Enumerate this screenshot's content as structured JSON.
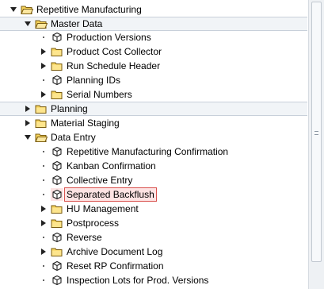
{
  "tree": {
    "root": "Repetitive Manufacturing",
    "master_data": {
      "label": "Master Data",
      "items": [
        "Production Versions",
        "Product Cost Collector",
        "Run Schedule Header",
        "Planning IDs",
        "Serial Numbers"
      ]
    },
    "planning": "Planning",
    "material_staging": "Material Staging",
    "data_entry": {
      "label": "Data Entry",
      "items": [
        "Repetitive Manufacturing Confirmation",
        "Kanban Confirmation",
        "Collective Entry",
        "Separated Backflush",
        "HU Management",
        "Postprocess",
        "Reverse",
        "Archive Document Log",
        "Reset RP Confirmation",
        "Inspection Lots for Prod. Versions"
      ]
    }
  },
  "icons": {
    "folder": "folder-icon",
    "transaction": "transaction-cube-icon",
    "expand": "triangle-right-icon",
    "collapse": "triangle-down-icon"
  },
  "colors": {
    "selection_border": "#d9534f",
    "selection_fill": "#fde3e3",
    "folder_yellow": "#f6d35b"
  }
}
